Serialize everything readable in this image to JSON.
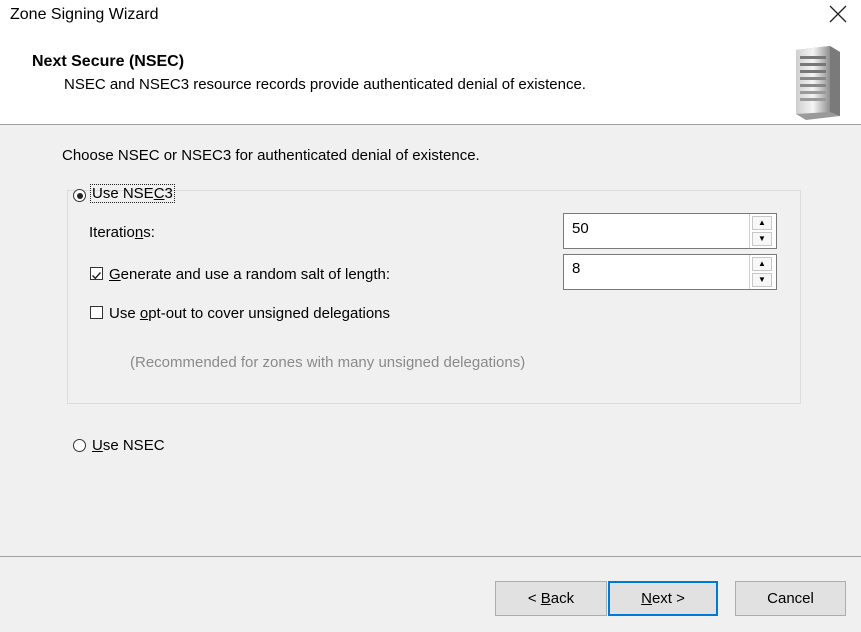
{
  "window": {
    "title": "Zone Signing Wizard"
  },
  "header": {
    "title": "Next Secure (NSEC)",
    "subtitle": "NSEC and NSEC3 resource records provide authenticated denial of existence."
  },
  "intro": "Choose NSEC or NSEC3 for authenticated denial of existence.",
  "nsec3": {
    "label_pre": "Use NSE",
    "label_accel": "C",
    "label_post": "3",
    "selected": true,
    "iterations": {
      "label_pre": "Iteratio",
      "label_accel": "n",
      "label_post": "s:",
      "value": "50"
    },
    "salt": {
      "label_accel": "G",
      "label_post": "enerate and use a random salt of length:",
      "checked": true,
      "value": "8"
    },
    "optout": {
      "label_pre": "Use ",
      "label_accel": "o",
      "label_post": "pt-out to cover unsigned delegations",
      "checked": false
    },
    "hint": "(Recommended for zones with many unsigned delegations)"
  },
  "nsec": {
    "label_accel": "U",
    "label_post": "se NSEC",
    "selected": false
  },
  "buttons": {
    "back": {
      "pre": "< ",
      "accel": "B",
      "post": "ack"
    },
    "next": {
      "accel": "N",
      "post": "ext >"
    },
    "cancel": "Cancel"
  }
}
